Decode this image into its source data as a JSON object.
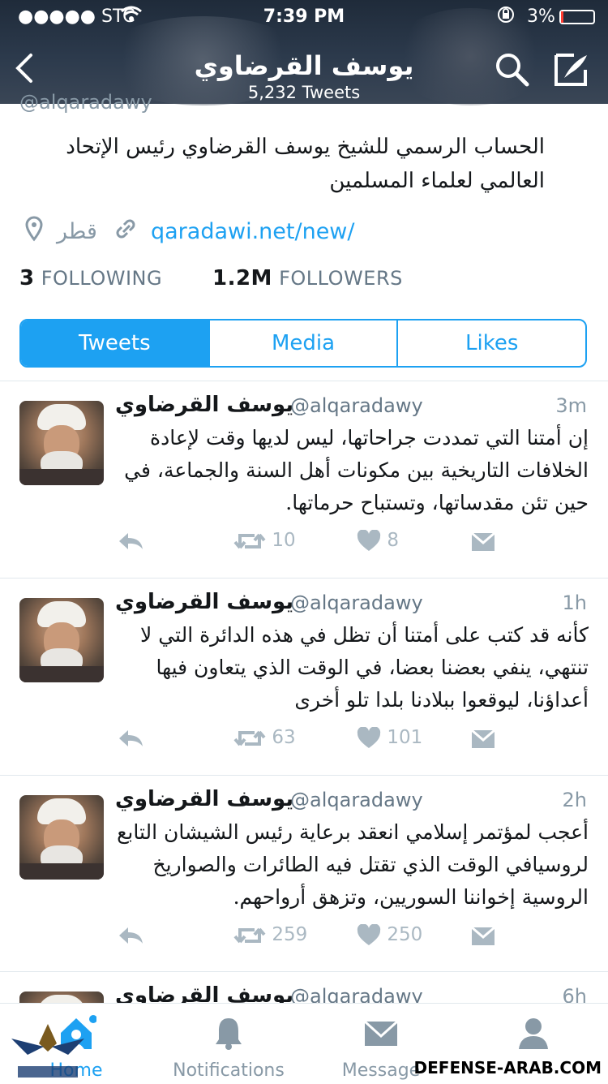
{
  "status_bar": {
    "carrier": "●●●●● STC",
    "time": "7:39 PM",
    "battery": "3%"
  },
  "header": {
    "title": "يوسف القرضاوي",
    "subtitle": "5,232 Tweets"
  },
  "profile": {
    "handle": "@alqaradawy",
    "bio": "الحساب الرسمي للشيخ يوسف القرضاوي رئيس الإتحاد العالمي لعلماء المسلمين",
    "location": "قطر",
    "url": "qaradawi.net/new/",
    "following_count": "3",
    "following_label": "FOLLOWING",
    "followers_count": "1.2M",
    "followers_label": "FOLLOWERS"
  },
  "tabs": [
    {
      "label": "Tweets"
    },
    {
      "label": "Media"
    },
    {
      "label": "Likes"
    }
  ],
  "tweets": [
    {
      "name": "يوسف القرضاوي",
      "handle": "@alqaradawy",
      "time": "3m",
      "text": "إن أمتنا التي تمددت جراحاتها، ليس لديها وقت لإعادة الخلافات التاريخية بين مكونات أهل السنة والجماعة، في حين تئن مقدساتها، وتستباح حرماتها.",
      "retweets": "10",
      "likes": "8"
    },
    {
      "name": "يوسف القرضاوي",
      "handle": "@alqaradawy",
      "time": "1h",
      "text": "كأنه قد كتب على أمتنا أن تظل في هذه الدائرة التي لا تنتهي، ينفي بعضنا بعضا، في الوقت الذي يتعاون فيها أعداؤنا، ليوقعوا ببلادنا بلدا تلو أخرى",
      "retweets": "63",
      "likes": "101"
    },
    {
      "name": "يوسف القرضاوي",
      "handle": "@alqaradawy",
      "time": "2h",
      "text": "أعجب لمؤتمر إسلامي انعقد برعاية رئيس الشيشان التابع لروسيافي الوقت الذي تقتل فيه الطائرات والصواريخ الروسية إخواننا السوريين، وتزهق أرواحهم.",
      "retweets": "259",
      "likes": "250"
    },
    {
      "name": "يوسف القرضاوي",
      "handle": "@alqaradawy",
      "time": "6h"
    }
  ],
  "tab_bar": [
    {
      "label": "Home",
      "icon": "home-icon"
    },
    {
      "label": "Notifications",
      "icon": "bell-icon"
    },
    {
      "label": "Message",
      "icon": "envelope-icon"
    },
    {
      "label": "",
      "icon": "profile-icon"
    }
  ],
  "watermark": "DEFENSE-ARAB.COM",
  "colors": {
    "accent": "#1da1f2",
    "muted": "#8899a6",
    "header_bg": "#2c3a4c"
  }
}
